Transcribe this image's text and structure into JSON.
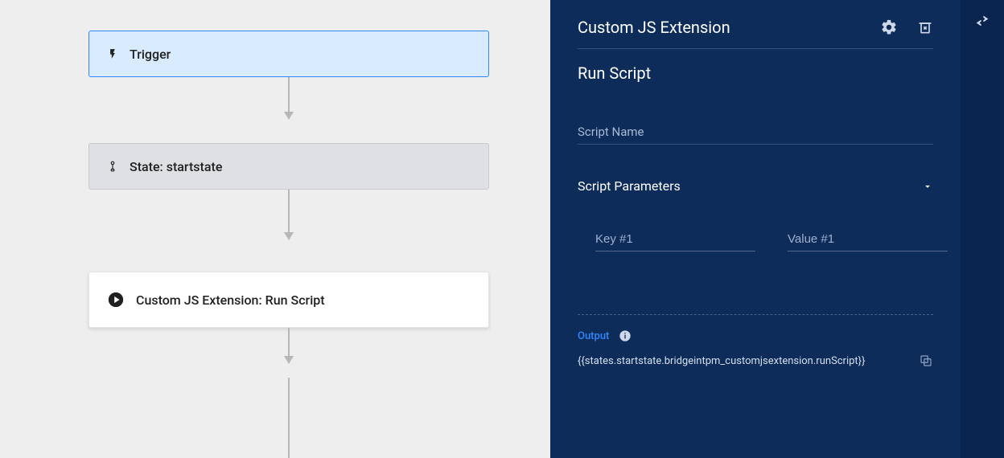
{
  "flow": {
    "trigger_label": "Trigger",
    "state_label": "State: startstate",
    "action_label": "Custom JS Extension: Run Script"
  },
  "panel": {
    "title": "Custom JS Extension",
    "subtitle": "Run Script",
    "script_name_label": "Script Name",
    "script_name_value": "",
    "params_label": "Script Parameters",
    "param_key_placeholder": "Key #1",
    "param_key_value": "",
    "param_value_placeholder": "Value #1",
    "param_value_value": "",
    "output_label": "Output",
    "output_expression": "{{states.startstate.bridgeintpm_customjsextension.runScript}}"
  }
}
